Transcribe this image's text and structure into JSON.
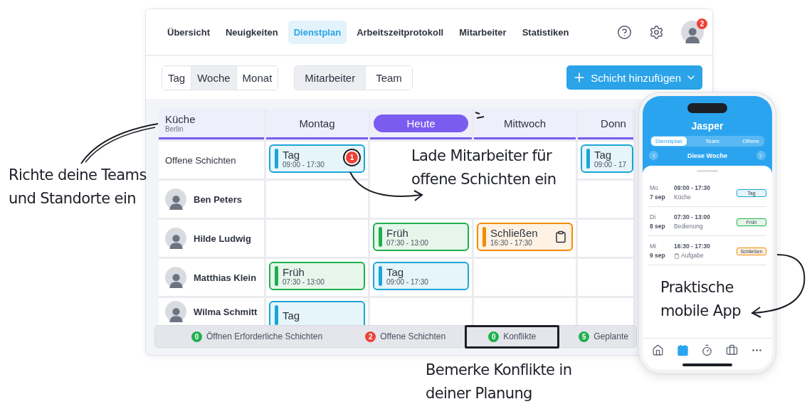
{
  "nav": {
    "items": [
      {
        "label": "Übersicht",
        "selected": false
      },
      {
        "label": "Neuigkeiten",
        "selected": false
      },
      {
        "label": "Dienstplan",
        "selected": true
      },
      {
        "label": "Arbeitszeitprotokoll",
        "selected": false
      },
      {
        "label": "Mitarbeiter",
        "selected": false
      },
      {
        "label": "Statistiken",
        "selected": false
      }
    ],
    "notifications": "2"
  },
  "toolbar": {
    "view_modes": [
      {
        "label": "Tag",
        "selected": false
      },
      {
        "label": "Woche",
        "selected": true
      },
      {
        "label": "Monat",
        "selected": false
      }
    ],
    "group_modes": [
      {
        "label": "Mitarbeiter",
        "selected": true
      },
      {
        "label": "Team",
        "selected": false
      }
    ],
    "add_button": "Schicht hinzufügen"
  },
  "schedule": {
    "team": "Küche",
    "location": "Berlin",
    "days": [
      {
        "label": "Montag",
        "selected": false
      },
      {
        "label": "Heute",
        "selected": true
      },
      {
        "label": "Mittwoch",
        "selected": false
      },
      {
        "label": "Donn",
        "selected": false
      }
    ],
    "rows": [
      {
        "name": "Offene Schichten",
        "kind": "open",
        "cells": [
          {
            "kind": "shift",
            "title": "Tag",
            "time": "09:00 - 17:30",
            "color": "#1aa6d6",
            "task": false,
            "badge": "1"
          },
          {
            "kind": "empty"
          },
          {
            "kind": "empty"
          },
          {
            "kind": "shift",
            "title": "Tag",
            "time": "09:00 - 17",
            "color": "#1aa6d6",
            "task": false
          }
        ]
      },
      {
        "name": "Ben Peters",
        "kind": "employee",
        "cells": [
          {
            "kind": "empty"
          },
          {
            "kind": "empty"
          },
          {
            "kind": "empty"
          },
          {
            "kind": "empty"
          }
        ]
      },
      {
        "name": "Hilde Ludwig",
        "kind": "employee",
        "cells": [
          {
            "kind": "empty"
          },
          {
            "kind": "shift",
            "title": "Früh",
            "time": "07:30 - 13:00",
            "color": "#1fb04c",
            "task": false
          },
          {
            "kind": "shift",
            "title": "Schließen",
            "time": "16:30 - 17:30",
            "color": "#f08c00",
            "task": true
          },
          {
            "kind": "empty"
          }
        ]
      },
      {
        "name": "Matthias Klein",
        "kind": "employee",
        "cells": [
          {
            "kind": "shift",
            "title": "Früh",
            "time": "07:30 - 13:00",
            "color": "#1fb04c",
            "task": false
          },
          {
            "kind": "shift",
            "title": "Tag",
            "time": "09:00 - 17:30",
            "color": "#1aa6d6",
            "task": false
          },
          {
            "kind": "empty"
          },
          {
            "kind": "empty"
          }
        ]
      },
      {
        "name": "Wilma Schmitt",
        "kind": "employee",
        "cells": [
          {
            "kind": "shift",
            "title": "Tag",
            "color": "#1aa6d6",
            "task": false
          },
          {
            "kind": "empty"
          },
          {
            "kind": "empty"
          },
          {
            "kind": "empty"
          }
        ]
      }
    ]
  },
  "summary": [
    {
      "count": "0",
      "label": "Öffnen Erforderliche Schichten",
      "color": "#1fb04c",
      "highlighted": false
    },
    {
      "count": "2",
      "label": "Offene Schichten",
      "color": "#ee4035",
      "highlighted": false
    },
    {
      "count": "0",
      "label": "Konflikte",
      "color": "#1fb04c",
      "highlighted": true
    },
    {
      "count": "5",
      "label": "Geplante",
      "color": "#1fb04c",
      "highlighted": false
    }
  ],
  "phone": {
    "user": "Jasper",
    "tabs": [
      {
        "label": "Dienstplan",
        "selected": true
      },
      {
        "label": "Team",
        "selected": false
      },
      {
        "label": "Offene",
        "selected": false
      }
    ],
    "week": "Diese Woche",
    "shifts": [
      {
        "weekday": "Mo",
        "date": "7 sep",
        "time": "09:00 - 17:30",
        "place": "Küche",
        "task": false,
        "tag": "Tag",
        "color": "#1aa6d6"
      },
      {
        "weekday": "Di",
        "date": "8 sep",
        "time": "07:30 - 13:00",
        "place": "Bedienung",
        "task": false,
        "tag": "Früh",
        "color": "#1fb04c"
      },
      {
        "weekday": "Mi",
        "date": "9 sep",
        "time": "16:30 - 17:30",
        "place": "Aufgabe",
        "task": true,
        "tag": "Schließen",
        "color": "#f08c00"
      }
    ],
    "bottom_nav": [
      {
        "selected": false
      },
      {
        "selected": true
      },
      {
        "selected": false
      },
      {
        "selected": false
      },
      {
        "selected": false
      }
    ]
  },
  "annotations": [
    {
      "text": "Richte deine Teams und Standorte ein"
    },
    {
      "text": "Lade Mitarbeiter für offene Schichten ein"
    },
    {
      "text": "Bemerke Konflikte in deiner Planung"
    },
    {
      "text": "Praktische mobile App"
    }
  ]
}
